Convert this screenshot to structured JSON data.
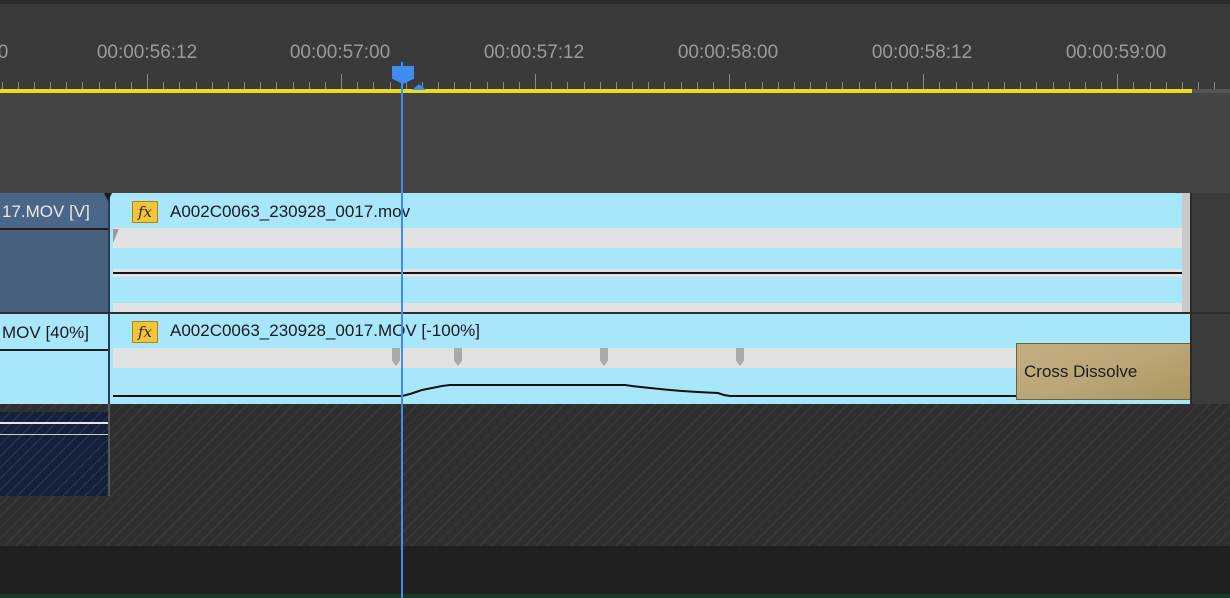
{
  "ruler": {
    "timecodes": [
      "00:00:56:12",
      "00:00:57:00",
      "00:00:57:12",
      "00:00:58:00",
      "00:00:58:12",
      "00:00:59:00"
    ],
    "left_partial": "0"
  },
  "video_track": {
    "prev_clip_label": "17.MOV [V]",
    "clip_name": "A002C0063_230928_0017.mov",
    "fx_label": "fx"
  },
  "audio_track": {
    "prev_clip_label": "MOV [40%]",
    "clip_name": "A002C0063_230928_0017.MOV [-100%]",
    "fx_label": "fx",
    "transition_label": "Cross Dissolve"
  },
  "colors": {
    "playhead": "#3d8ef0",
    "work_area_bar": "#e8df1e",
    "clip_fill": "#a8e6fb",
    "transition": "#bda979",
    "fx_badge": "#f0c53a"
  }
}
